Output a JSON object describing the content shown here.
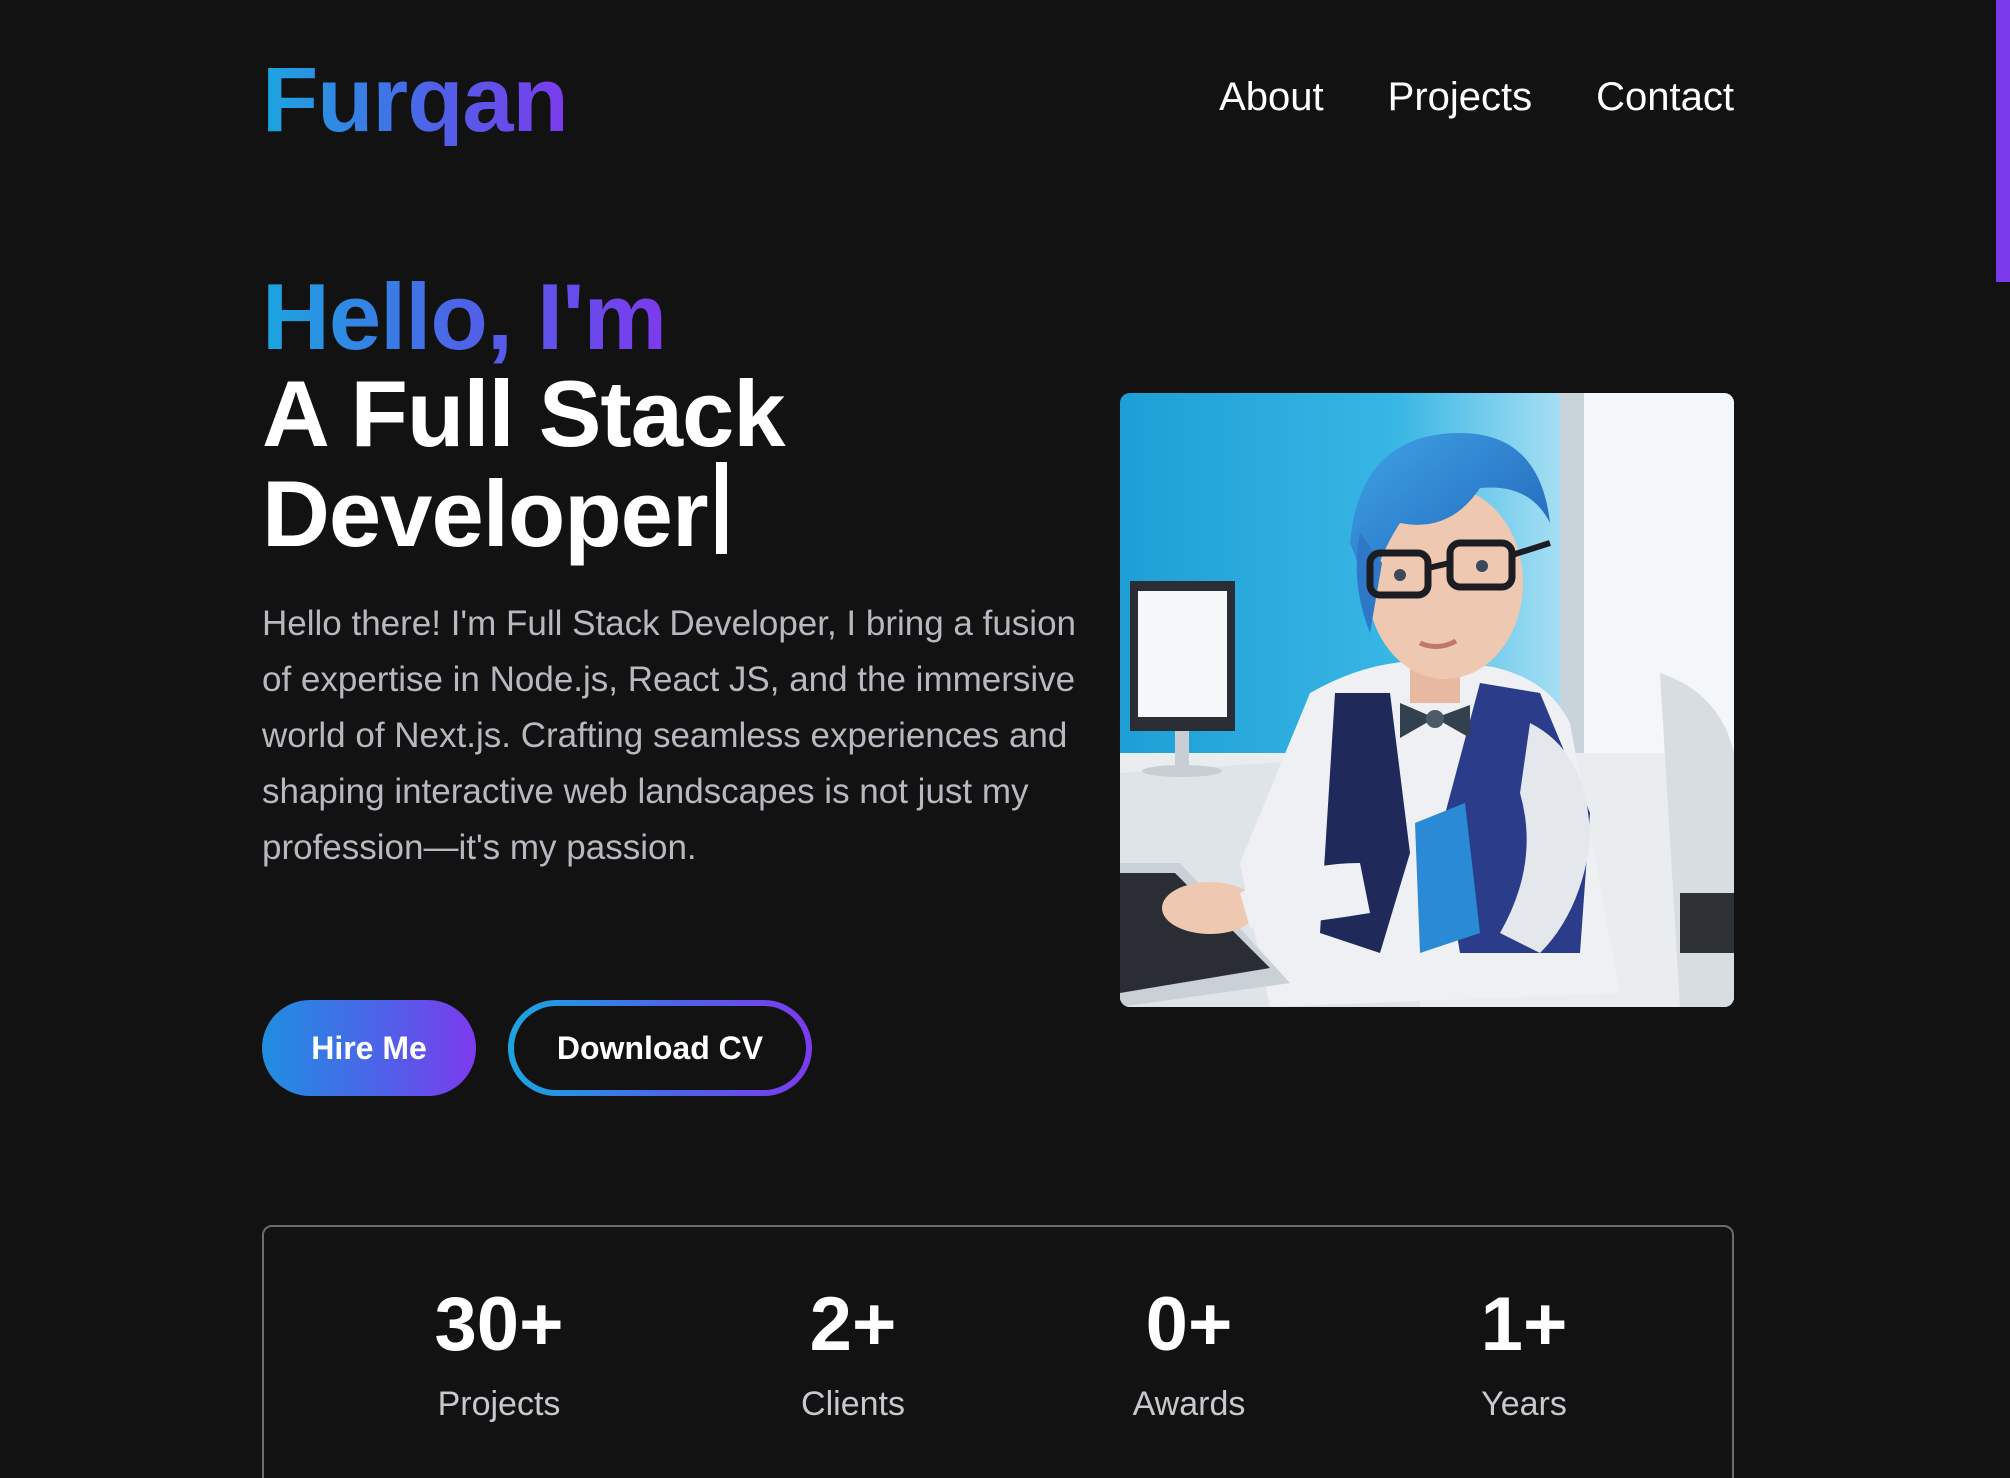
{
  "header": {
    "logo": "Furqan",
    "nav": [
      "About",
      "Projects",
      "Contact"
    ]
  },
  "hero": {
    "greeting": "Hello, I'm",
    "role_line1": "A Full Stack",
    "role_line2": "Developer",
    "intro": "Hello there! I'm Full Stack Developer, I bring a fusion of expertise in Node.js, React JS, and the immersive world of Next.js. Crafting seamless experiences and shaping interactive web landscapes is not just my profession—it's my passion.",
    "buttons": {
      "hire": "Hire Me",
      "download": "Download CV"
    }
  },
  "stats": [
    {
      "value": "30+",
      "label": "Projects"
    },
    {
      "value": "2+",
      "label": "Clients"
    },
    {
      "value": "0+",
      "label": "Awards"
    },
    {
      "value": "1+",
      "label": "Years"
    }
  ],
  "colors": {
    "background": "#121212",
    "accent_start": "#1aa6e0",
    "accent_mid": "#4d63e8",
    "accent_end": "#7c3aed",
    "scrollbar": "#7c3aed"
  }
}
